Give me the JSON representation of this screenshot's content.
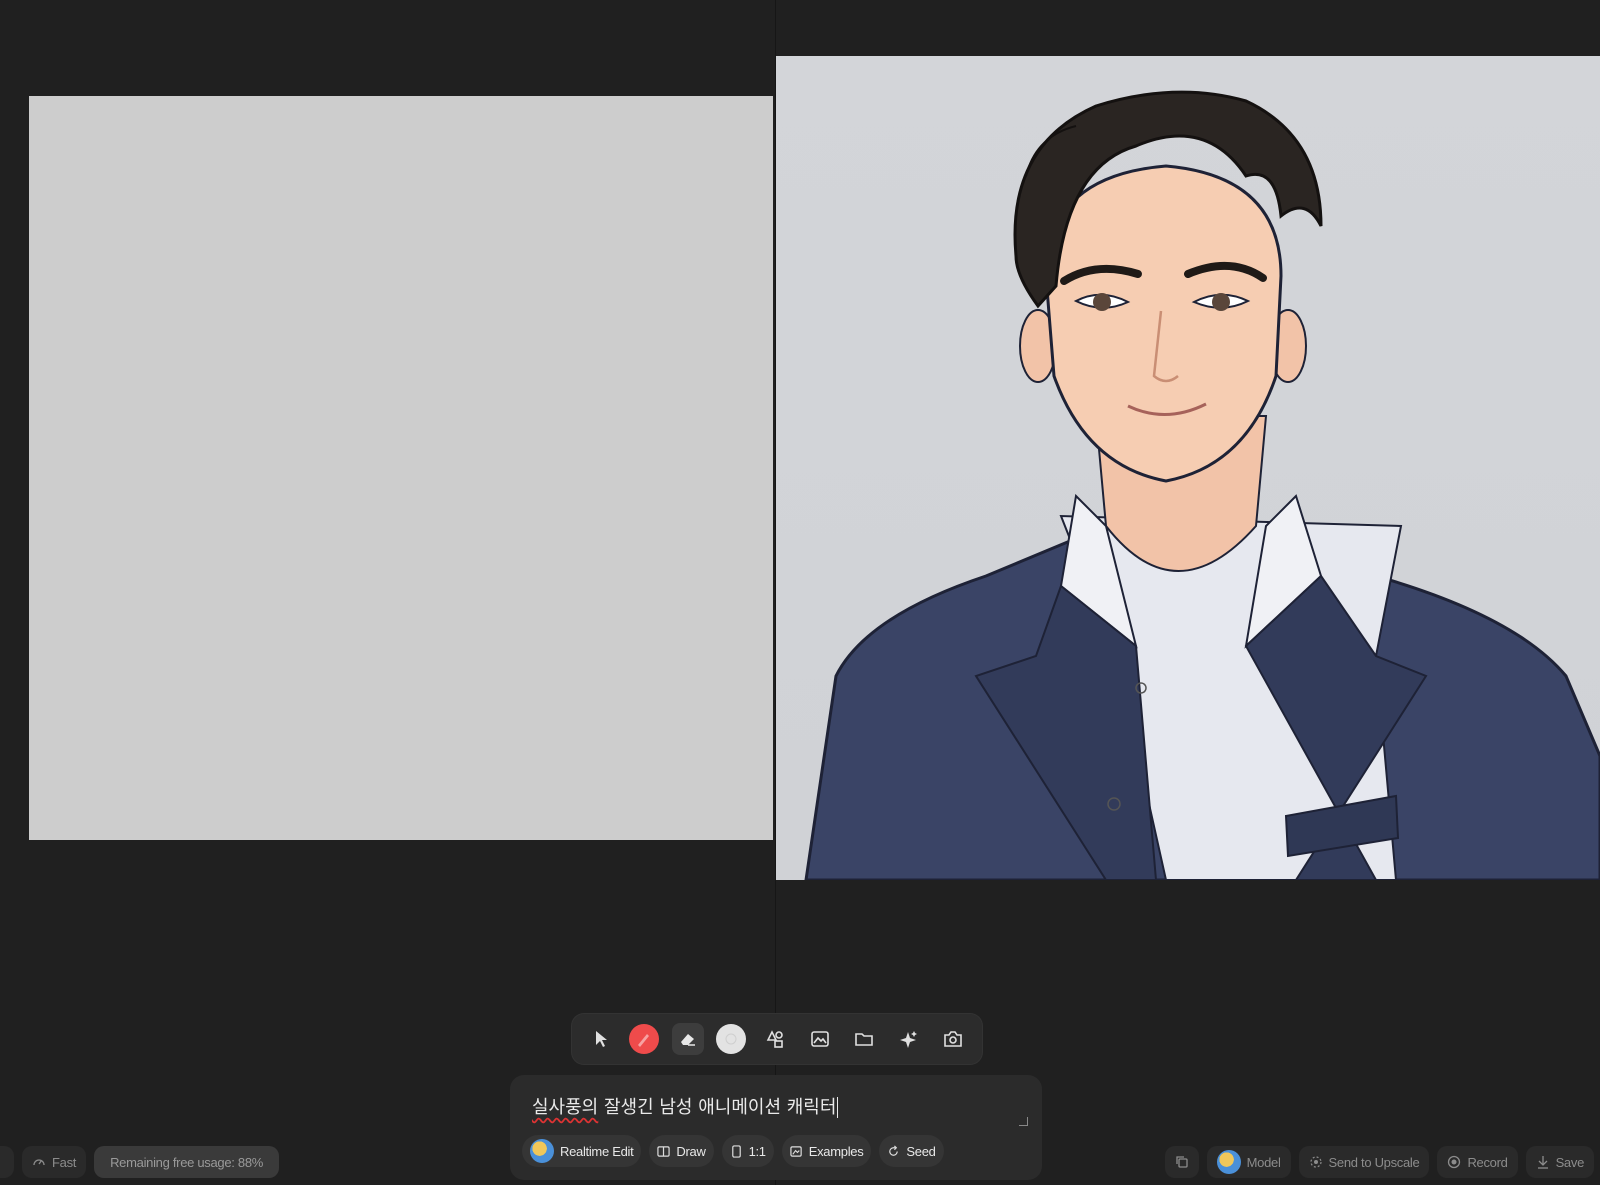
{
  "toolbar": {
    "tools": [
      {
        "name": "select-tool",
        "icon": "cursor-icon"
      },
      {
        "name": "brush-tool",
        "icon": "brush-icon"
      },
      {
        "name": "eraser-tool",
        "icon": "eraser-icon"
      },
      {
        "name": "color-picker",
        "icon": "color-swatch-icon"
      },
      {
        "name": "shapes-tool",
        "icon": "shapes-icon"
      },
      {
        "name": "image-tool",
        "icon": "image-icon"
      },
      {
        "name": "folder-tool",
        "icon": "folder-icon"
      },
      {
        "name": "magic-tool",
        "icon": "sparkle-icon"
      },
      {
        "name": "capture-tool",
        "icon": "camera-icon"
      }
    ],
    "brush_color": "#ef4b4b",
    "swatch_color": "#e3e3e3"
  },
  "prompt": {
    "text_underlined": "실사풍의",
    "text_rest": " 잘생긴 남성 애니메이션 캐릭터"
  },
  "chips": {
    "realtime_edit": "Realtime Edit",
    "draw": "Draw",
    "ratio": "1:1",
    "examples": "Examples",
    "seed": "Seed"
  },
  "status": {
    "speed": "Fast",
    "usage": "Remaining free usage: 88%"
  },
  "actions": {
    "model": "Model",
    "send_to_upscale": "Send to Upscale",
    "record": "Record",
    "save": "Save"
  },
  "colors": {
    "background": "#202020",
    "canvas": "#cdcdcd",
    "accent_red": "#ef4b4b"
  }
}
